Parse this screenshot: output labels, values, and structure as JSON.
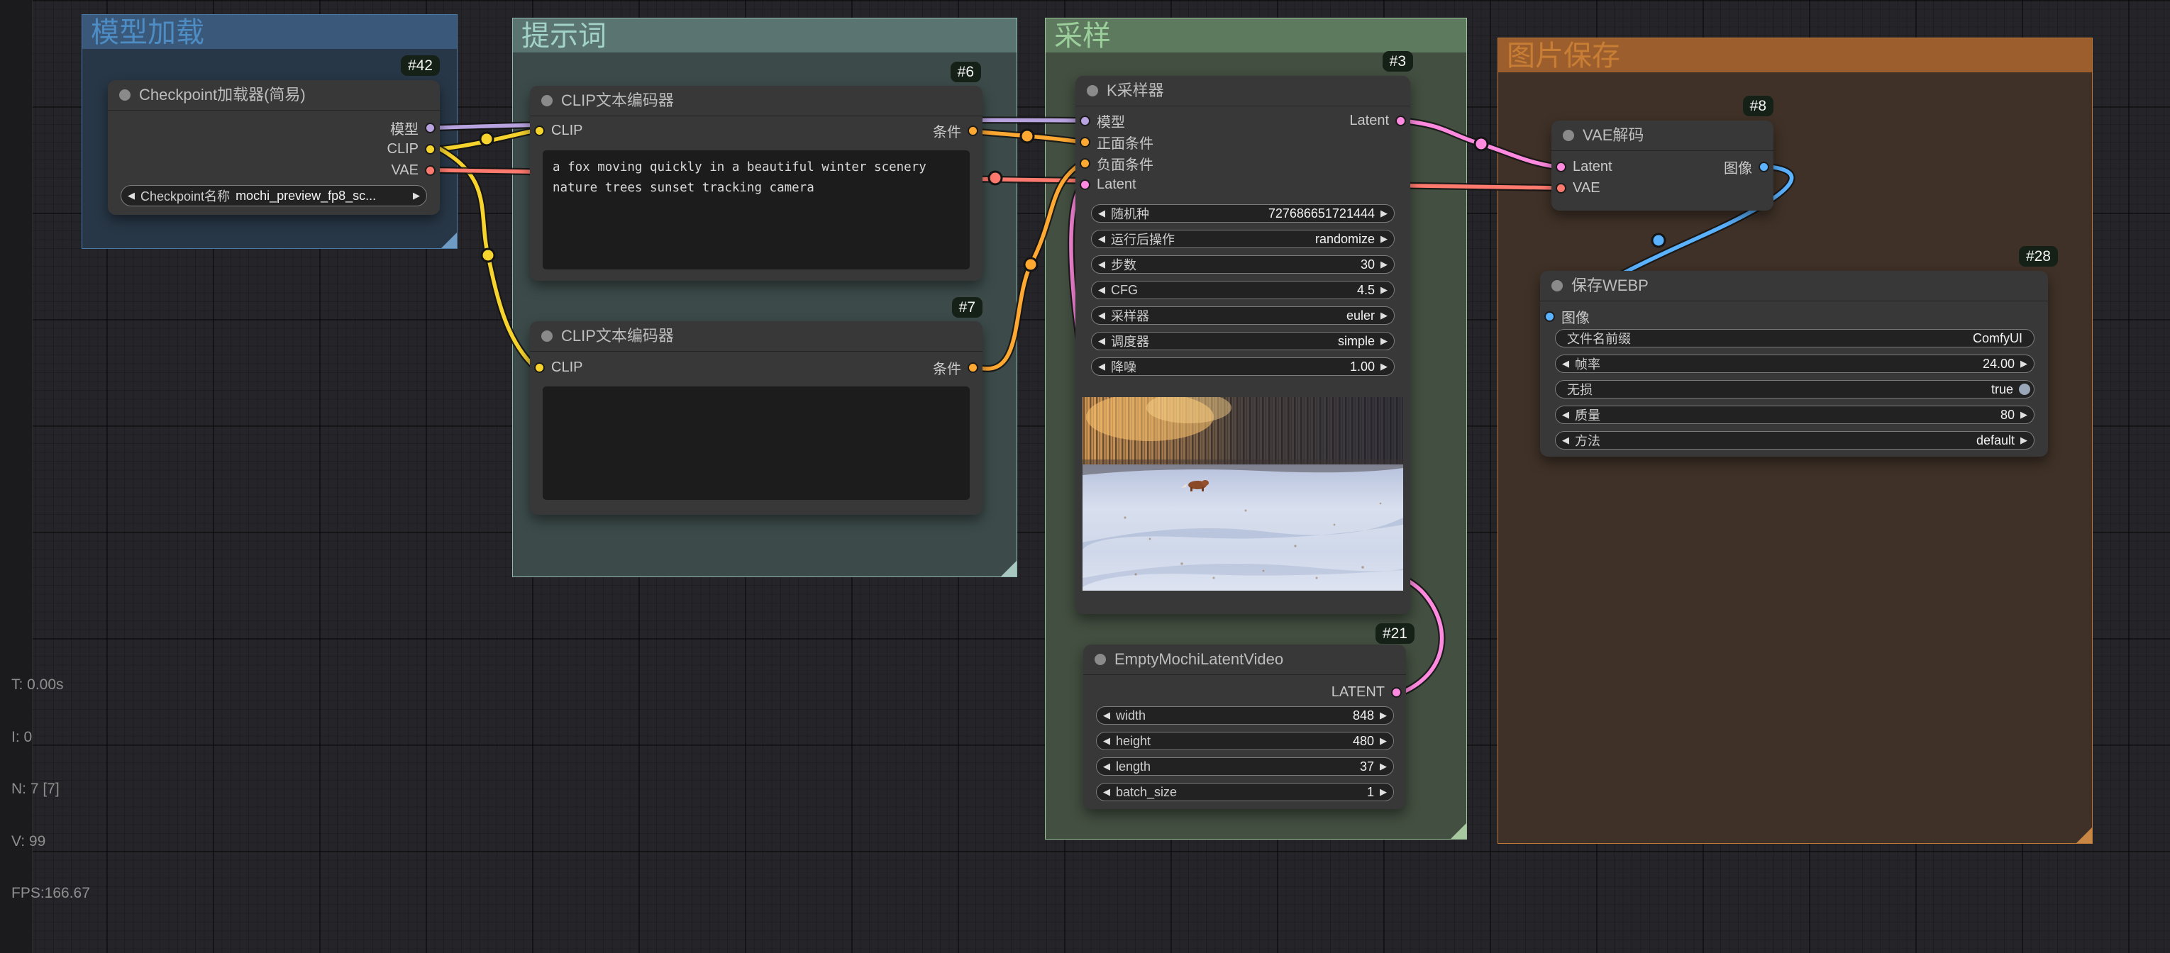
{
  "ui": {
    "arrow_left": "◀",
    "arrow_right": "▶"
  },
  "stats": {
    "lines": [
      "T: 0.00s",
      "I: 0",
      "N: 7 [7]",
      "V: 99",
      "FPS:166.67"
    ]
  },
  "groups": {
    "model_load": {
      "title": "模型加载"
    },
    "prompt": {
      "title": "提示词"
    },
    "sampling": {
      "title": "采样"
    },
    "image_save": {
      "title": "图片保存"
    }
  },
  "nodes": {
    "checkpoint_loader": {
      "badge": "#42",
      "title": "Checkpoint加载器(简易)",
      "outputs": {
        "model": "模型",
        "clip": "CLIP",
        "vae": "VAE"
      },
      "widgets": {
        "ckpt_name": {
          "label": "Checkpoint名称",
          "value": "mochi_preview_fp8_sc..."
        }
      }
    },
    "clip_encode_positive": {
      "badge": "#6",
      "title": "CLIP文本编码器",
      "inputs": {
        "clip": "CLIP"
      },
      "outputs": {
        "cond": "条件"
      },
      "text": "a fox moving quickly in a beautiful winter scenery nature trees sunset tracking camera"
    },
    "clip_encode_negative": {
      "badge": "#7",
      "title": "CLIP文本编码器",
      "inputs": {
        "clip": "CLIP"
      },
      "outputs": {
        "cond": "条件"
      },
      "text": ""
    },
    "ksampler": {
      "badge": "#3",
      "title": "K采样器",
      "inputs": {
        "model": "模型",
        "positive": "正面条件",
        "negative": "负面条件",
        "latent": "Latent"
      },
      "outputs": {
        "latent": "Latent"
      },
      "widgets": [
        {
          "label": "随机种",
          "value": "727686651721444"
        },
        {
          "label": "运行后操作",
          "value": "randomize"
        },
        {
          "label": "步数",
          "value": "30"
        },
        {
          "label": "CFG",
          "value": "4.5"
        },
        {
          "label": "采样器",
          "value": "euler"
        },
        {
          "label": "调度器",
          "value": "simple"
        },
        {
          "label": "降噪",
          "value": "1.00"
        }
      ]
    },
    "empty_mochi_latent": {
      "badge": "#21",
      "title": "EmptyMochiLatentVideo",
      "outputs": {
        "latent": "LATENT"
      },
      "widgets": [
        {
          "label": "width",
          "value": "848"
        },
        {
          "label": "height",
          "value": "480"
        },
        {
          "label": "length",
          "value": "37"
        },
        {
          "label": "batch_size",
          "value": "1"
        }
      ]
    },
    "vae_decode": {
      "badge": "#8",
      "title": "VAE解码",
      "inputs": {
        "latent": "Latent",
        "vae": "VAE"
      },
      "outputs": {
        "image": "图像"
      }
    },
    "save_webp": {
      "badge": "#28",
      "title": "保存WEBP",
      "inputs": {
        "image": "图像"
      },
      "widgets": [
        {
          "label": "文件名前缀",
          "value": "ComfyUI",
          "type": "text"
        },
        {
          "label": "帧率",
          "value": "24.00",
          "type": "stepper"
        },
        {
          "label": "无损",
          "value": "true",
          "type": "toggle"
        },
        {
          "label": "质量",
          "value": "80",
          "type": "stepper"
        },
        {
          "label": "方法",
          "value": "default",
          "type": "stepper"
        }
      ]
    }
  },
  "colors": {
    "model": "#b8a3e0",
    "clip": "#f6d32d",
    "vae": "#ff7a6e",
    "conditioning": "#ffa832",
    "latent": "#ff8ae0",
    "image": "#5bb2ff"
  }
}
